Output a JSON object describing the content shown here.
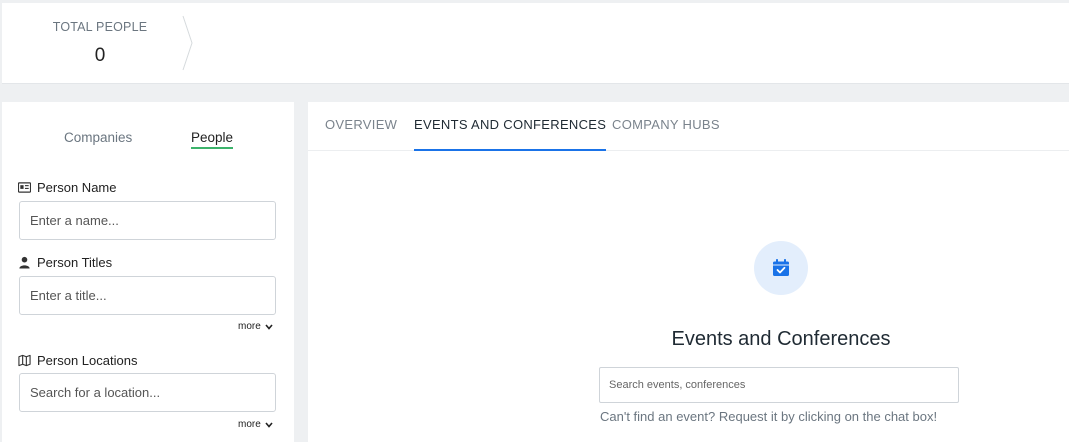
{
  "stats": {
    "total_people_label": "TOTAL PEOPLE",
    "total_people_value": "0"
  },
  "left_panel": {
    "tabs": [
      {
        "label": "Companies",
        "active": false
      },
      {
        "label": "People",
        "active": true
      }
    ],
    "filters": {
      "person_name": {
        "label": "Person Name",
        "icon": "id-card-icon",
        "placeholder": "Enter a name..."
      },
      "person_titles": {
        "label": "Person Titles",
        "icon": "person-icon",
        "placeholder": "Enter a title...",
        "more_label": "more"
      },
      "person_locations": {
        "label": "Person Locations",
        "icon": "map-icon",
        "placeholder": "Search for a location...",
        "more_label": "more"
      }
    }
  },
  "main_panel": {
    "tabs": [
      {
        "label": "OVERVIEW",
        "active": false
      },
      {
        "label": "EVENTS AND CONFERENCES",
        "active": true
      },
      {
        "label": "COMPANY HUBS",
        "active": false
      }
    ],
    "empty_state": {
      "icon": "calendar-check-icon",
      "title": "Events and Conferences",
      "search_placeholder": "Search events, conferences",
      "help_text": "Can't find an event? Request it by clicking on the chat box!"
    }
  },
  "colors": {
    "accent_blue": "#1a73e8",
    "people_tab_underline": "#3cb36b",
    "icon_circle_bg": "#e3eefc"
  }
}
